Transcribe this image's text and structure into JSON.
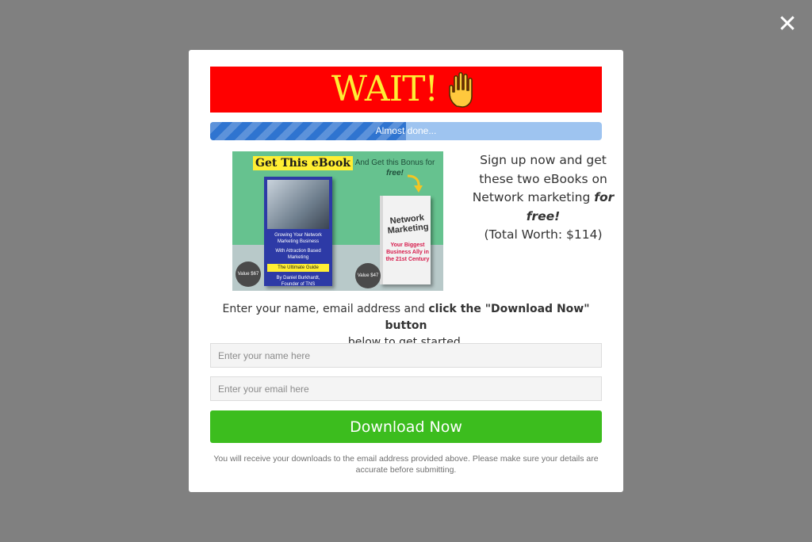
{
  "overlay": {
    "close_symbol": "✕",
    "background_color": "#808080"
  },
  "banner": {
    "title": "WAIT!",
    "icon": "raised-hand-icon",
    "background_color": "#ff0000",
    "text_color": "#ffee33"
  },
  "progress": {
    "label": "Almost done...",
    "percent": 50,
    "fill_color": "#2f74d0",
    "track_color": "#9ec4f0"
  },
  "promo": {
    "heading": "Get This eBook",
    "bonus_line": "And Get this Bonus for",
    "bonus_emphasis": "free!",
    "book1_title": "Growing Your Network Marketing Business",
    "book1_subtitle": "With Attraction Based Marketing",
    "book1_guide": "The Ultimate Guide",
    "book1_author": "By Daniel Burkhardt, Founder of TNS",
    "book2_title": "Network Marketing",
    "book2_subtitle": "Your Biggest Business Ally in the 21st Century",
    "badge1": "Value $67",
    "badge2": "Value $47"
  },
  "signup": {
    "text": "Sign up now and get these two eBooks on Network marketing",
    "emphasis": "for free!",
    "worth": "(Total Worth: $114)"
  },
  "instructions": {
    "before": "Enter your name, email address and",
    "bold": "click the \"Download Now\" button",
    "after": "below to get started."
  },
  "form": {
    "name_placeholder": "Enter your name here",
    "email_placeholder": "Enter your email here",
    "submit_label": "Download Now",
    "submit_color": "#3cbd1e"
  },
  "disclaimer": "You will receive your downloads to the email address provided above. Please make sure your details are accurate before submitting."
}
